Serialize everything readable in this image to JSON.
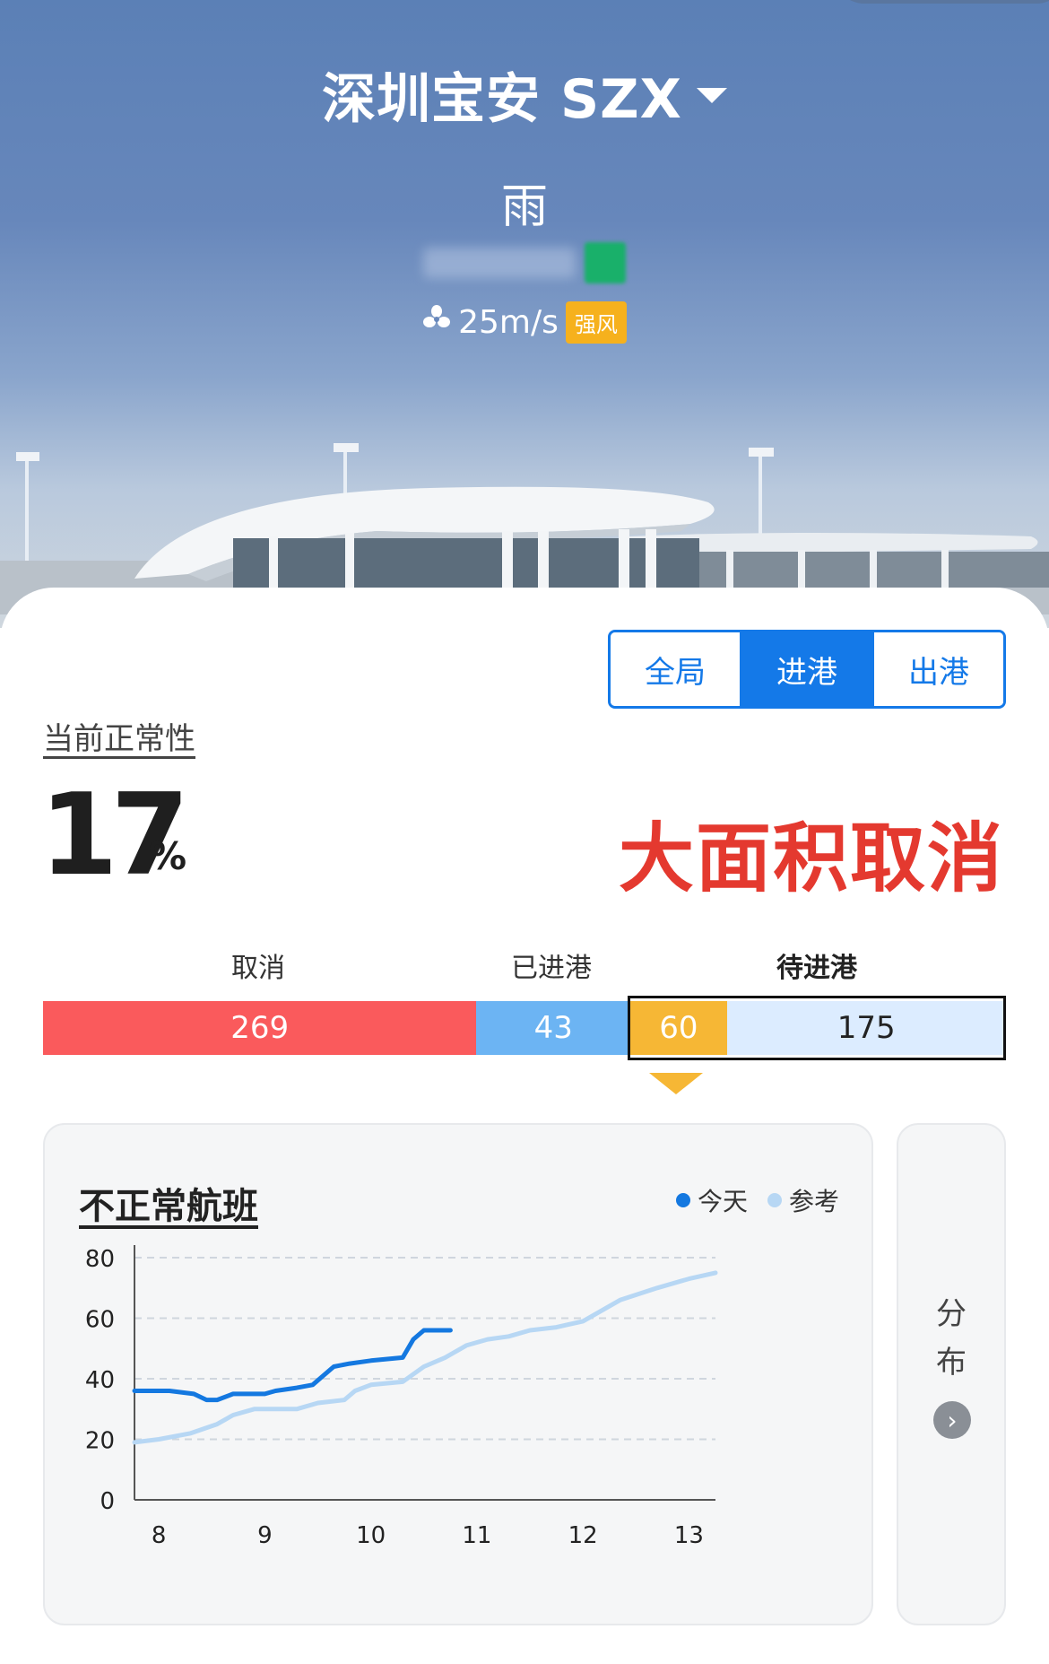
{
  "header": {
    "airport": "深圳宝安 SZX",
    "weather": "雨",
    "wind_speed": "25m/s",
    "wind_level": "强风",
    "wind_badge_color": "#f6b11d"
  },
  "tabs": [
    {
      "label": "全局",
      "active": false
    },
    {
      "label": "进港",
      "active": true
    },
    {
      "label": "出港",
      "active": false
    }
  ],
  "normality": {
    "label": "当前正常性",
    "value": "17",
    "unit": "%",
    "status": "大面积取消",
    "status_color": "#e4392f"
  },
  "flight_bar": {
    "labels": {
      "cancelled": "取消",
      "arrived": "已进港",
      "pending": "待进港"
    },
    "segments": [
      {
        "key": "cancelled",
        "value": "269",
        "color": "#fa5a5c"
      },
      {
        "key": "arrived",
        "value": "43",
        "color": "#6cb4f3"
      },
      {
        "key": "delayed",
        "value": "60",
        "color": "#f6b735"
      },
      {
        "key": "waiting",
        "value": "175",
        "color": "#dcecff"
      }
    ]
  },
  "chart_panel": {
    "title": "不正常航班",
    "legend_today": "今天",
    "legend_reference": "参考",
    "side_label_1": "分",
    "side_label_2": "布"
  },
  "chart_data": {
    "type": "line",
    "title": "不正常航班",
    "xlabel": "",
    "ylabel": "",
    "x_ticks": [
      "8",
      "9",
      "10",
      "11",
      "12",
      "13"
    ],
    "y_ticks": [
      "0",
      "20",
      "40",
      "60",
      "80"
    ],
    "xlim": [
      7.77,
      13.25
    ],
    "ylim": [
      0,
      80
    ],
    "grid": true,
    "legend_position": "top-right",
    "series": [
      {
        "name": "今天",
        "color": "#1478e0",
        "points": [
          [
            7.77,
            36
          ],
          [
            8.1,
            36
          ],
          [
            8.33,
            35
          ],
          [
            8.45,
            33
          ],
          [
            8.55,
            33
          ],
          [
            8.7,
            35
          ],
          [
            9.0,
            35
          ],
          [
            9.1,
            36
          ],
          [
            9.3,
            37
          ],
          [
            9.45,
            38
          ],
          [
            9.55,
            41
          ],
          [
            9.65,
            44
          ],
          [
            9.8,
            45
          ],
          [
            10.0,
            46
          ],
          [
            10.3,
            47
          ],
          [
            10.4,
            53
          ],
          [
            10.5,
            56
          ],
          [
            10.75,
            56
          ]
        ]
      },
      {
        "name": "参考",
        "color": "#b7d7f4",
        "points": [
          [
            7.77,
            19
          ],
          [
            8.0,
            20
          ],
          [
            8.3,
            22
          ],
          [
            8.55,
            25
          ],
          [
            8.7,
            28
          ],
          [
            8.9,
            30
          ],
          [
            9.3,
            30
          ],
          [
            9.5,
            32
          ],
          [
            9.75,
            33
          ],
          [
            9.85,
            36
          ],
          [
            10.0,
            38
          ],
          [
            10.3,
            39
          ],
          [
            10.5,
            44
          ],
          [
            10.7,
            47
          ],
          [
            10.9,
            51
          ],
          [
            11.1,
            53
          ],
          [
            11.3,
            54
          ],
          [
            11.5,
            56
          ],
          [
            11.75,
            57
          ],
          [
            12.0,
            59
          ],
          [
            12.15,
            62
          ],
          [
            12.35,
            66
          ],
          [
            12.7,
            70
          ],
          [
            13.0,
            73
          ],
          [
            13.25,
            75
          ]
        ]
      }
    ]
  }
}
